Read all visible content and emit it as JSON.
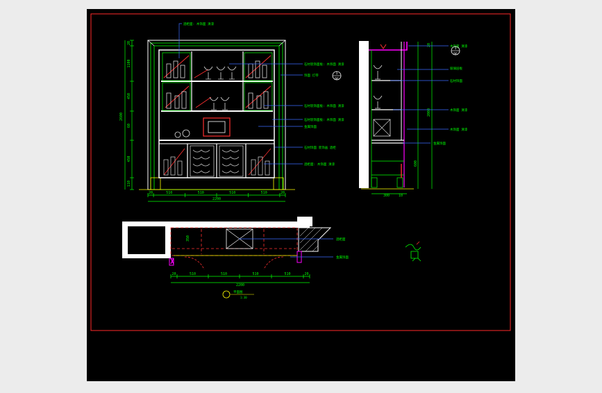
{
  "colors": {
    "background": "#ececec",
    "paper": "#000000",
    "frame": "#ff2a2a",
    "dim": "#00ff00",
    "leader": "#3b6bff",
    "outline": "#ffffff",
    "hidden": "#ff3030",
    "accent": "#ff00ff",
    "detail": "#ffff00"
  },
  "elevation": {
    "bottom_dims": [
      "20",
      "510",
      "510",
      "510",
      "510",
      "20"
    ],
    "overall_width": "2200",
    "height_dims": [
      "20",
      "1100",
      "450",
      "60",
      "450",
      "110"
    ],
    "overall_height": "2600",
    "labels": [
      "酒柜面: 木饰面 清漆",
      "石材装饰面板: 木饰面 清漆",
      "饰面 灯带",
      "石材装饰面板: 木饰面 清漆",
      "石材装饰面板: 木饰面 清漆",
      "金属饰面",
      "石材饰面 装饰画 酒柜",
      "酒柜面: 木饰面 清漆"
    ],
    "section_mark": {
      "num": "1",
      "sheet": "B6"
    }
  },
  "section": {
    "labels": [
      "玻璃层板",
      "石材饰面",
      "木饰面 清漆",
      "木饰面 清漆",
      "木饰面 清漆",
      "金属饰面"
    ],
    "dims_right": [
      "20",
      "2000",
      "600"
    ],
    "dims_bottom": [
      "300",
      "10"
    ],
    "section_mark": {
      "num": "1",
      "sheet": "B6"
    }
  },
  "plan": {
    "bottom_dims": [
      "20",
      "510",
      "510",
      "510",
      "510",
      "20"
    ],
    "overall_width": "2200",
    "side_dim": "350",
    "labels": [
      "酒柜面",
      "金属饰面"
    ],
    "title": "平面图",
    "scale": "1:30"
  }
}
